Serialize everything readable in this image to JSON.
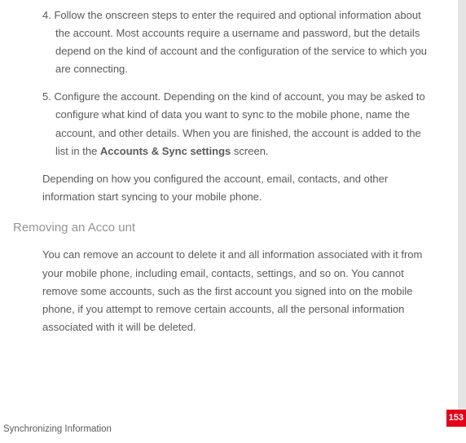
{
  "steps": [
    {
      "num": "4. ",
      "text": "Follow the onscreen steps to enter the required and optional information about the account. Most accounts require a username and password, but the details depend on the kind of account and the configuration of the service to which you are connecting."
    },
    {
      "num": "5. ",
      "text_before": "Configure the account. Depending on the kind of account, you may be asked to configure what kind of data you want to sync to the mobile phone, name the account, and other details. When you are finished, the account is added to the list in the ",
      "bold": "Accounts & Sync settings",
      "text_after": " screen."
    }
  ],
  "follow_text": "Depending on how you configured the account, email, contacts, and other information start syncing to your mobile phone.",
  "section_heading": "Removing an  Acco unt",
  "removing_text": "You can remove an account to delete it and all information associated with it from your mobile phone, including email, contacts, settings, and so on. You cannot remove some accounts, such as the first account you signed into on the mobile phone,  if you attempt to remove certain accounts, all the personal information associated with it will be deleted.",
  "page_number": "153",
  "footer": "Synchronizing Information"
}
